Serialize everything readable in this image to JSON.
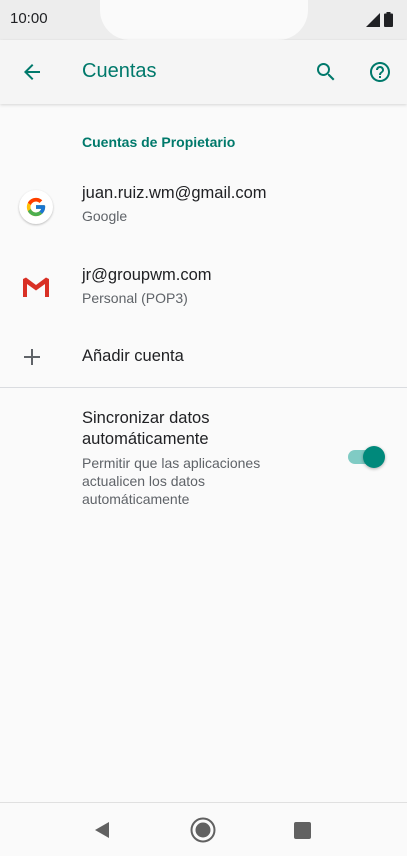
{
  "status_bar": {
    "time": "10:00",
    "icons": [
      "signal-icon",
      "battery-icon"
    ]
  },
  "app_bar": {
    "title": "Cuentas",
    "back_icon": "arrow-left-icon",
    "search_icon": "search-icon",
    "help_icon": "help-circle-icon"
  },
  "section": {
    "header": "Cuentas de Propietario"
  },
  "accounts": [
    {
      "email": "juan.ruiz.wm@gmail.com",
      "type": "Google",
      "icon": "google-logo-icon"
    },
    {
      "email": "jr@groupwm.com",
      "type": "Personal (POP3)",
      "icon": "gmail-logo-icon"
    }
  ],
  "add_account": {
    "label": "Añadir cuenta",
    "icon": "plus-icon"
  },
  "sync": {
    "title": "Sincronizar datos automáticamente",
    "subtitle": "Permitir que las aplicaciones actualicen los datos automáticamente",
    "enabled": true
  },
  "colors": {
    "accent": "#00796b",
    "toggle_thumb": "#00897b",
    "toggle_track": "#80cbc4"
  },
  "nav_bar": {
    "icons": [
      "nav-back-icon",
      "nav-home-icon",
      "nav-recents-icon"
    ]
  }
}
